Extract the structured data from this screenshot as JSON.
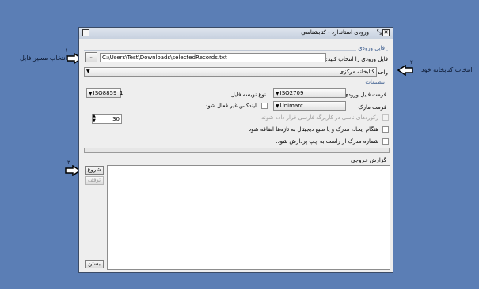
{
  "annotations": {
    "step1_number": "۱",
    "step1_label": "انتخاب مسیر فایل",
    "step2_number": "۲",
    "step2_label": "انتخاب کتابخانه خود",
    "step3_number": "۳"
  },
  "window": {
    "title": "ورودی استاندارد - کتابشناسی"
  },
  "input_file": {
    "section_title": "فایل ورودی",
    "prompt": "فایل ورودی را انتخاب کنید:",
    "path_value": "C:\\Users\\Test\\Downloads\\selectedRecords.txt",
    "browse_label": "...",
    "unit_label": "واحد",
    "library_value": "کتابخانه مرکزی"
  },
  "settings": {
    "section_title": "تنظیمات",
    "input_format_label": "فرمت فایل ورودی",
    "input_format_value": "ISO2709",
    "writer_type_label": "نوع نویسه فایل",
    "writer_type_value": "ISO8859_1",
    "marc_format_label": "فرمت مارک",
    "marc_format_value": "Unimarc",
    "reindex_label": "ایندکس غیر فعال شود.",
    "sync_label": "رکوردهای ناسی در کاربرگه فارسی قرار داده شوند",
    "digital_label": "هنگام ایجاد، مدرک و یا منبع دیجیتال به تازه‌ها اضافه شود",
    "digital_value": "30",
    "rtl_label": "شماره مدرک از راست به چپ پردازش شود."
  },
  "output": {
    "report_label": "گزارش خروجی",
    "start_label": "شروع",
    "stop_label": "توقف",
    "close_label": "بستن"
  }
}
